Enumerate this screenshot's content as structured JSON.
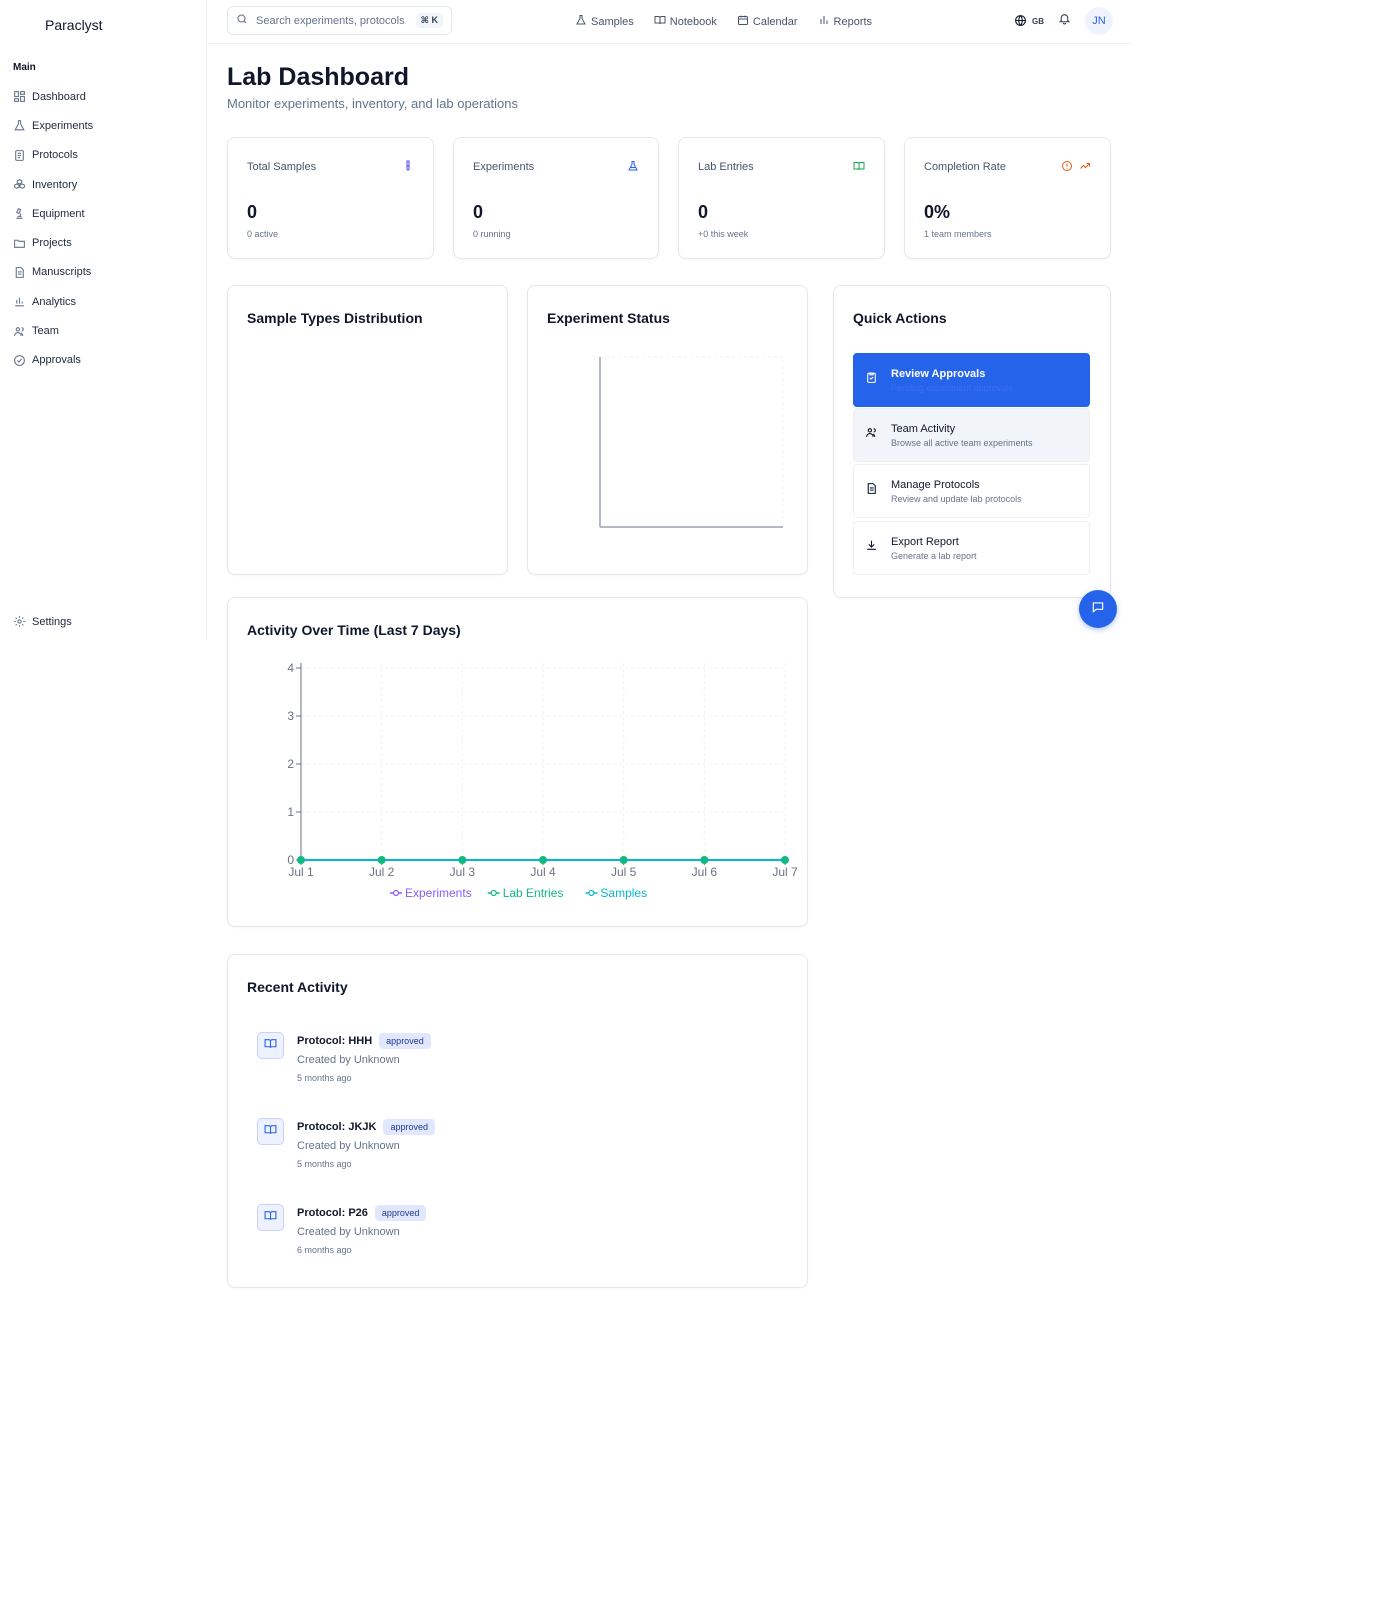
{
  "app": {
    "brand": "Paraclyst"
  },
  "sidebar": {
    "section": "Main",
    "items": [
      {
        "label": "Dashboard",
        "icon": "dashboard-icon"
      },
      {
        "label": "Experiments",
        "icon": "flask-icon"
      },
      {
        "label": "Protocols",
        "icon": "document-icon"
      },
      {
        "label": "Inventory",
        "icon": "boxes-icon"
      },
      {
        "label": "Equipment",
        "icon": "microscope-icon"
      },
      {
        "label": "Projects",
        "icon": "folder-icon"
      },
      {
        "label": "Manuscripts",
        "icon": "file-text-icon"
      },
      {
        "label": "Analytics",
        "icon": "bar-chart-icon"
      },
      {
        "label": "Team",
        "icon": "users-icon"
      },
      {
        "label": "Approvals",
        "icon": "check-circle-icon"
      }
    ],
    "settings": "Settings"
  },
  "topbar": {
    "search_placeholder": "Search experiments, protocols...",
    "shortcut": "⌘ K",
    "nav": [
      {
        "label": "Samples",
        "icon": "flask-icon"
      },
      {
        "label": "Notebook",
        "icon": "book-icon"
      },
      {
        "label": "Calendar",
        "icon": "calendar-icon"
      },
      {
        "label": "Reports",
        "icon": "bar-chart-icon"
      }
    ],
    "language": "GB",
    "avatar": "JN"
  },
  "header": {
    "title": "Lab Dashboard",
    "subtitle": "Monitor experiments, inventory, and lab operations"
  },
  "stats": [
    {
      "label": "Total Samples",
      "value": "0",
      "sub": "0 active",
      "icon": "test-tube-icon",
      "color": "#4f46e5"
    },
    {
      "label": "Experiments",
      "value": "0",
      "sub": "0 running",
      "icon": "flask-icon",
      "color": "#2563eb"
    },
    {
      "label": "Lab Entries",
      "value": "0",
      "sub": "+0 this week",
      "icon": "book-icon",
      "color": "#16a34a"
    },
    {
      "label": "Completion Rate",
      "value": "0%",
      "sub": "1 team members",
      "icon": "trending-up-icon",
      "color": "#ea580c"
    }
  ],
  "panels": {
    "sample_types": "Sample Types Distribution",
    "experiment_status": "Experiment Status",
    "activity": "Activity Over Time (Last 7 Days)",
    "recent": "Recent Activity"
  },
  "quick_actions": {
    "title": "Quick Actions",
    "items": [
      {
        "title": "Review Approvals",
        "desc": "Pending experiment approvals",
        "icon": "clipboard-check-icon"
      },
      {
        "title": "Team Activity",
        "desc": "Browse all active team experiments",
        "icon": "users-icon"
      },
      {
        "title": "Manage Protocols",
        "desc": "Review and update lab protocols",
        "icon": "document-icon"
      },
      {
        "title": "Export Report",
        "desc": "Generate a lab report",
        "icon": "download-icon"
      }
    ]
  },
  "chart_data": {
    "type": "line",
    "title": "Activity Over Time (Last 7 Days)",
    "categories": [
      "Jul 1",
      "Jul 2",
      "Jul 3",
      "Jul 4",
      "Jul 5",
      "Jul 6",
      "Jul 7"
    ],
    "series": [
      {
        "name": "Experiments",
        "values": [
          0,
          0,
          0,
          0,
          0,
          0,
          0
        ],
        "color": "#8b5cf6"
      },
      {
        "name": "Lab Entries",
        "values": [
          0,
          0,
          0,
          0,
          0,
          0,
          0
        ],
        "color": "#10b981"
      },
      {
        "name": "Samples",
        "values": [
          0,
          0,
          0,
          0,
          0,
          0,
          0
        ],
        "color": "#06b6d4"
      }
    ],
    "ylim": [
      0,
      4
    ],
    "yticks": [
      "0",
      "1",
      "2",
      "3",
      "4"
    ],
    "grid": true,
    "legend": "bottom"
  },
  "recent_activity": [
    {
      "title": "Protocol: HHH",
      "status": "approved",
      "by": "Created by Unknown",
      "when": "5 months ago"
    },
    {
      "title": "Protocol: JKJK",
      "status": "approved",
      "by": "Created by Unknown",
      "when": "5 months ago"
    },
    {
      "title": "Protocol: P26",
      "status": "approved",
      "by": "Created by Unknown",
      "when": "6 months ago"
    }
  ]
}
